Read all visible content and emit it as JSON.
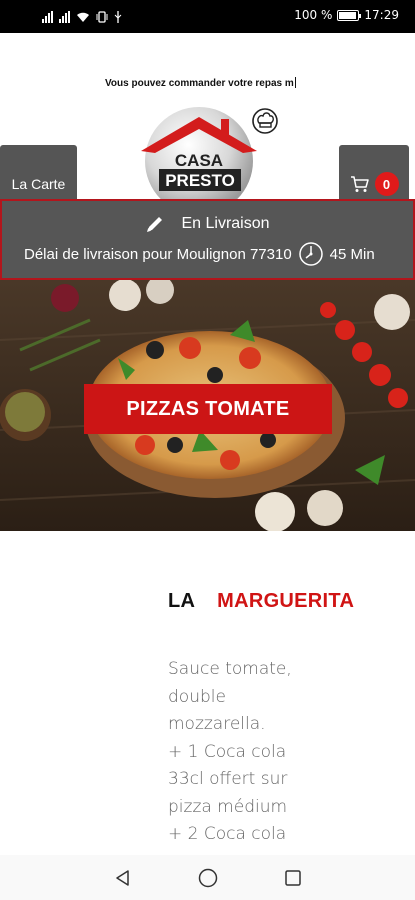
{
  "status_bar": {
    "battery_percent": "100 %",
    "time": "17:29"
  },
  "header": {
    "marquee_text": "Vous pouvez commander votre repas m",
    "menu_button_label": "La Carte",
    "cart_count": "0",
    "logo_line1": "CASA",
    "logo_line2": "PRESTO"
  },
  "delivery": {
    "mode": "En Livraison",
    "delay_text": "Délai de livraison pour Moulignon 77310",
    "duration": "45 Min"
  },
  "hero": {
    "button_label": "PIZZAS TOMATE"
  },
  "product": {
    "title_prefix": "LA",
    "title_name": "MARGUERITA",
    "description_lines": [
      "Sauce tomate,",
      "double",
      "mozzarella.",
      "+ 1 Coca cola",
      "33cl offert sur",
      "pizza médium",
      "+ 2 Coca cola"
    ]
  },
  "colors": {
    "accent_red": "#cc1515",
    "panel_gray": "#565656",
    "button_gray": "#555555"
  },
  "icons": {
    "pencil": "pencil-icon",
    "clock": "clock-icon",
    "cart": "cart-icon",
    "back": "back-icon",
    "home": "home-icon",
    "recents": "recents-icon"
  }
}
